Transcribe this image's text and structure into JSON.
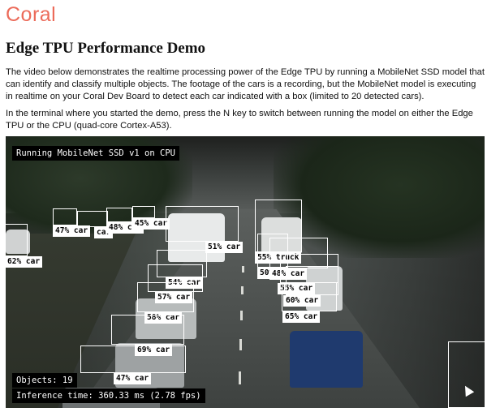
{
  "brand": {
    "logo_text": "Coral"
  },
  "page": {
    "title": "Edge TPU Performance Demo",
    "paragraph_1": "The video below demonstrates the realtime processing power of the Edge TPU by running a MobileNet SSD model that can identify and classify multiple objects. The footage of the cars is a recording, but the MobileNet model is executing in realtime on your Coral Dev Board to detect each car indicated with a box (limited to 20 detected cars).",
    "paragraph_2": "In the terminal where you started the demo, press the N key to switch between running the model on either the Edge TPU or the CPU (quad-core Cortex-A53)."
  },
  "video": {
    "mode_text": "Running MobileNet SSD v1 on CPU",
    "objects_text": "Objects: 19",
    "inference_text": "Inference time: 360.33 ms (2.78 fps)",
    "detections": [
      {
        "label": "47% car"
      },
      {
        "label": "car"
      },
      {
        "label": "48% car"
      },
      {
        "label": "45% car"
      },
      {
        "label": "51% car"
      },
      {
        "label": "62% car"
      },
      {
        "label": "55% truck"
      },
      {
        "label": "50%"
      },
      {
        "label": "48% car"
      },
      {
        "label": "54% car"
      },
      {
        "label": "57% car"
      },
      {
        "label": "55% car"
      },
      {
        "label": "60% car"
      },
      {
        "label": "58% car"
      },
      {
        "label": "65% car"
      },
      {
        "label": "69% car"
      },
      {
        "label": "47% car"
      },
      {
        "label": ""
      },
      {
        "label": ""
      }
    ]
  },
  "colors": {
    "brand_accent": "#ec6b5a",
    "box_color": "#ffffff",
    "overlay_bg": "#000000"
  }
}
